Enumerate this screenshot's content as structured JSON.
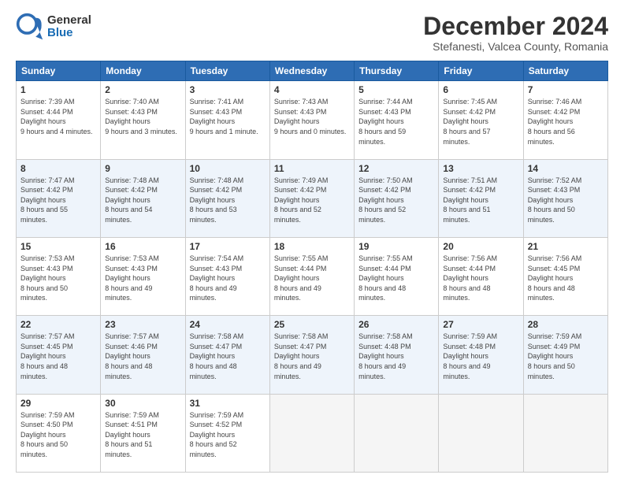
{
  "header": {
    "logo_general": "General",
    "logo_blue": "Blue",
    "month_title": "December 2024",
    "location": "Stefanesti, Valcea County, Romania"
  },
  "days_of_week": [
    "Sunday",
    "Monday",
    "Tuesday",
    "Wednesday",
    "Thursday",
    "Friday",
    "Saturday"
  ],
  "weeks": [
    [
      {
        "day": "1",
        "sunrise": "7:39 AM",
        "sunset": "4:44 PM",
        "daylight": "9 hours and 4 minutes."
      },
      {
        "day": "2",
        "sunrise": "7:40 AM",
        "sunset": "4:43 PM",
        "daylight": "9 hours and 3 minutes."
      },
      {
        "day": "3",
        "sunrise": "7:41 AM",
        "sunset": "4:43 PM",
        "daylight": "9 hours and 1 minute."
      },
      {
        "day": "4",
        "sunrise": "7:43 AM",
        "sunset": "4:43 PM",
        "daylight": "9 hours and 0 minutes."
      },
      {
        "day": "5",
        "sunrise": "7:44 AM",
        "sunset": "4:43 PM",
        "daylight": "8 hours and 59 minutes."
      },
      {
        "day": "6",
        "sunrise": "7:45 AM",
        "sunset": "4:42 PM",
        "daylight": "8 hours and 57 minutes."
      },
      {
        "day": "7",
        "sunrise": "7:46 AM",
        "sunset": "4:42 PM",
        "daylight": "8 hours and 56 minutes."
      }
    ],
    [
      {
        "day": "8",
        "sunrise": "7:47 AM",
        "sunset": "4:42 PM",
        "daylight": "8 hours and 55 minutes."
      },
      {
        "day": "9",
        "sunrise": "7:48 AM",
        "sunset": "4:42 PM",
        "daylight": "8 hours and 54 minutes."
      },
      {
        "day": "10",
        "sunrise": "7:48 AM",
        "sunset": "4:42 PM",
        "daylight": "8 hours and 53 minutes."
      },
      {
        "day": "11",
        "sunrise": "7:49 AM",
        "sunset": "4:42 PM",
        "daylight": "8 hours and 52 minutes."
      },
      {
        "day": "12",
        "sunrise": "7:50 AM",
        "sunset": "4:42 PM",
        "daylight": "8 hours and 52 minutes."
      },
      {
        "day": "13",
        "sunrise": "7:51 AM",
        "sunset": "4:42 PM",
        "daylight": "8 hours and 51 minutes."
      },
      {
        "day": "14",
        "sunrise": "7:52 AM",
        "sunset": "4:43 PM",
        "daylight": "8 hours and 50 minutes."
      }
    ],
    [
      {
        "day": "15",
        "sunrise": "7:53 AM",
        "sunset": "4:43 PM",
        "daylight": "8 hours and 50 minutes."
      },
      {
        "day": "16",
        "sunrise": "7:53 AM",
        "sunset": "4:43 PM",
        "daylight": "8 hours and 49 minutes."
      },
      {
        "day": "17",
        "sunrise": "7:54 AM",
        "sunset": "4:43 PM",
        "daylight": "8 hours and 49 minutes."
      },
      {
        "day": "18",
        "sunrise": "7:55 AM",
        "sunset": "4:44 PM",
        "daylight": "8 hours and 49 minutes."
      },
      {
        "day": "19",
        "sunrise": "7:55 AM",
        "sunset": "4:44 PM",
        "daylight": "8 hours and 48 minutes."
      },
      {
        "day": "20",
        "sunrise": "7:56 AM",
        "sunset": "4:44 PM",
        "daylight": "8 hours and 48 minutes."
      },
      {
        "day": "21",
        "sunrise": "7:56 AM",
        "sunset": "4:45 PM",
        "daylight": "8 hours and 48 minutes."
      }
    ],
    [
      {
        "day": "22",
        "sunrise": "7:57 AM",
        "sunset": "4:45 PM",
        "daylight": "8 hours and 48 minutes."
      },
      {
        "day": "23",
        "sunrise": "7:57 AM",
        "sunset": "4:46 PM",
        "daylight": "8 hours and 48 minutes."
      },
      {
        "day": "24",
        "sunrise": "7:58 AM",
        "sunset": "4:47 PM",
        "daylight": "8 hours and 48 minutes."
      },
      {
        "day": "25",
        "sunrise": "7:58 AM",
        "sunset": "4:47 PM",
        "daylight": "8 hours and 49 minutes."
      },
      {
        "day": "26",
        "sunrise": "7:58 AM",
        "sunset": "4:48 PM",
        "daylight": "8 hours and 49 minutes."
      },
      {
        "day": "27",
        "sunrise": "7:59 AM",
        "sunset": "4:48 PM",
        "daylight": "8 hours and 49 minutes."
      },
      {
        "day": "28",
        "sunrise": "7:59 AM",
        "sunset": "4:49 PM",
        "daylight": "8 hours and 50 minutes."
      }
    ],
    [
      {
        "day": "29",
        "sunrise": "7:59 AM",
        "sunset": "4:50 PM",
        "daylight": "8 hours and 50 minutes."
      },
      {
        "day": "30",
        "sunrise": "7:59 AM",
        "sunset": "4:51 PM",
        "daylight": "8 hours and 51 minutes."
      },
      {
        "day": "31",
        "sunrise": "7:59 AM",
        "sunset": "4:52 PM",
        "daylight": "8 hours and 52 minutes."
      },
      null,
      null,
      null,
      null
    ]
  ],
  "labels": {
    "sunrise": "Sunrise:",
    "sunset": "Sunset:",
    "daylight": "Daylight hours"
  }
}
